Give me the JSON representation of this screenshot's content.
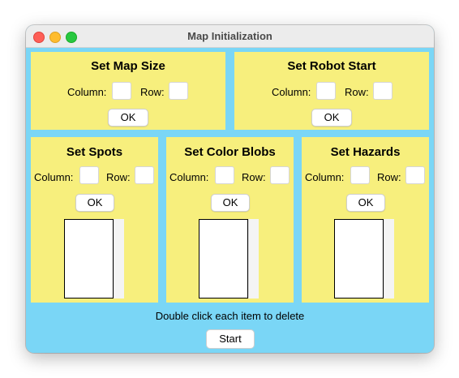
{
  "window": {
    "title": "Map Initialization"
  },
  "map_size": {
    "title": "Set Map Size",
    "column_label": "Column:",
    "row_label": "Row:",
    "ok_label": "OK"
  },
  "robot_start": {
    "title": "Set Robot Start",
    "column_label": "Column:",
    "row_label": "Row:",
    "ok_label": "OK"
  },
  "spots": {
    "title": "Set Spots",
    "column_label": "Column:",
    "row_label": "Row:",
    "ok_label": "OK"
  },
  "color_blobs": {
    "title": "Set Color Blobs",
    "column_label": "Column:",
    "row_label": "Row:",
    "ok_label": "OK"
  },
  "hazards": {
    "title": "Set Hazards",
    "column_label": "Column:",
    "row_label": "Row:",
    "ok_label": "OK"
  },
  "footer": {
    "hint": "Double click each item to delete",
    "start_label": "Start"
  },
  "colors": {
    "background": "#7ad6f6",
    "panel": "#f7ef7d"
  }
}
